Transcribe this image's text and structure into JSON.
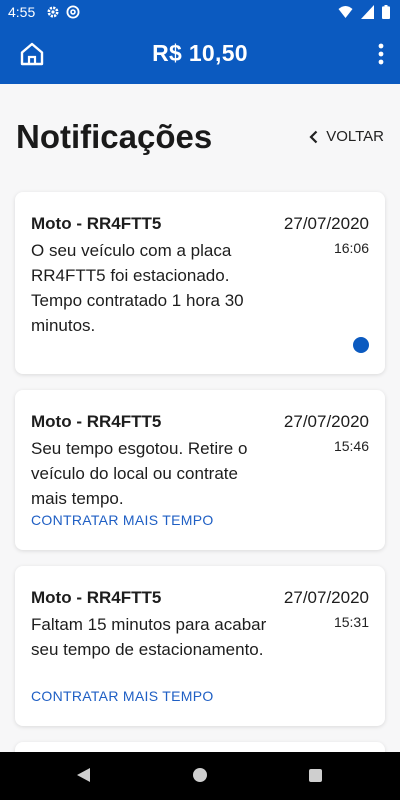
{
  "status_bar": {
    "time": "4:55"
  },
  "header": {
    "balance": "R$ 10,50"
  },
  "page": {
    "title": "Notificações",
    "back_label": "VOLTAR"
  },
  "notifications": [
    {
      "title": "Moto - RR4FTT5",
      "date": "27/07/2020",
      "time": "16:06",
      "message": "O seu veículo com a placa RR4FTT5 foi estacionado. Tempo contratado 1 hora 30 minutos.",
      "unread": true
    },
    {
      "title": "Moto - RR4FTT5",
      "date": "27/07/2020",
      "time": "15:46",
      "message": "Seu tempo esgotou. Retire o veículo do local ou contrate mais tempo.",
      "action": "CONTRATAR MAIS TEMPO"
    },
    {
      "title": "Moto - RR4FTT5",
      "date": "27/07/2020",
      "time": "15:31",
      "message": "Faltam 15 minutos para acabar seu tempo de estacionamento.",
      "action": "CONTRATAR MAIS TEMPO"
    }
  ],
  "colors": {
    "primary": "#0b5ac0",
    "link": "#1f5fc4"
  },
  "icons": [
    "gear-icon",
    "at-icon",
    "wifi-icon",
    "signal-icon",
    "battery-icon",
    "home-icon",
    "more-vert-icon",
    "chevron-left-icon",
    "nav-back-icon",
    "nav-home-icon",
    "nav-recent-icon"
  ]
}
